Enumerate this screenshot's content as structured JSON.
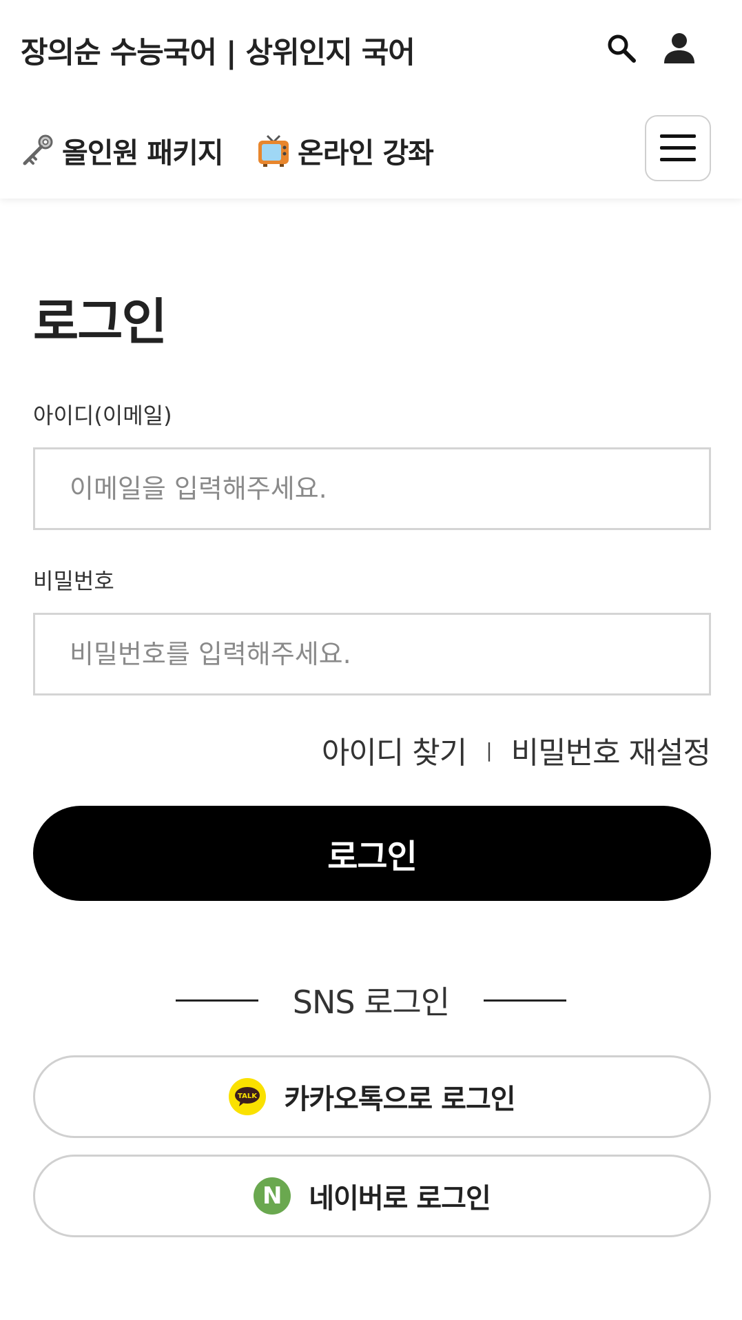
{
  "header": {
    "site_title": "장의순 수능국어 | 상위인지 국어",
    "icons": {
      "search": "search-icon",
      "user": "user-icon",
      "menu": "hamburger-menu-icon"
    }
  },
  "nav": {
    "items": [
      {
        "emoji": "key-icon",
        "label": "올인원 패키지"
      },
      {
        "emoji": "tv-icon",
        "label": "온라인 강좌"
      }
    ]
  },
  "login": {
    "title": "로그인",
    "id_label": "아이디(이메일)",
    "id_placeholder": "이메일을 입력해주세요.",
    "pw_label": "비밀번호",
    "pw_placeholder": "비밀번호를 입력해주세요.",
    "find_id": "아이디 찾기",
    "separator": "|",
    "reset_pw": "비밀번호 재설정",
    "submit_label": "로그인"
  },
  "sns": {
    "divider_label": "SNS 로그인",
    "kakao_label": "카카오톡으로 로그인",
    "kakao_icon_text": "TALK",
    "naver_label": "네이버로 로그인",
    "naver_icon_text": "N"
  },
  "colors": {
    "primary_button": "#000000",
    "kakao": "#fae100",
    "naver": "#6aa84f",
    "border": "#d4d4d4"
  }
}
